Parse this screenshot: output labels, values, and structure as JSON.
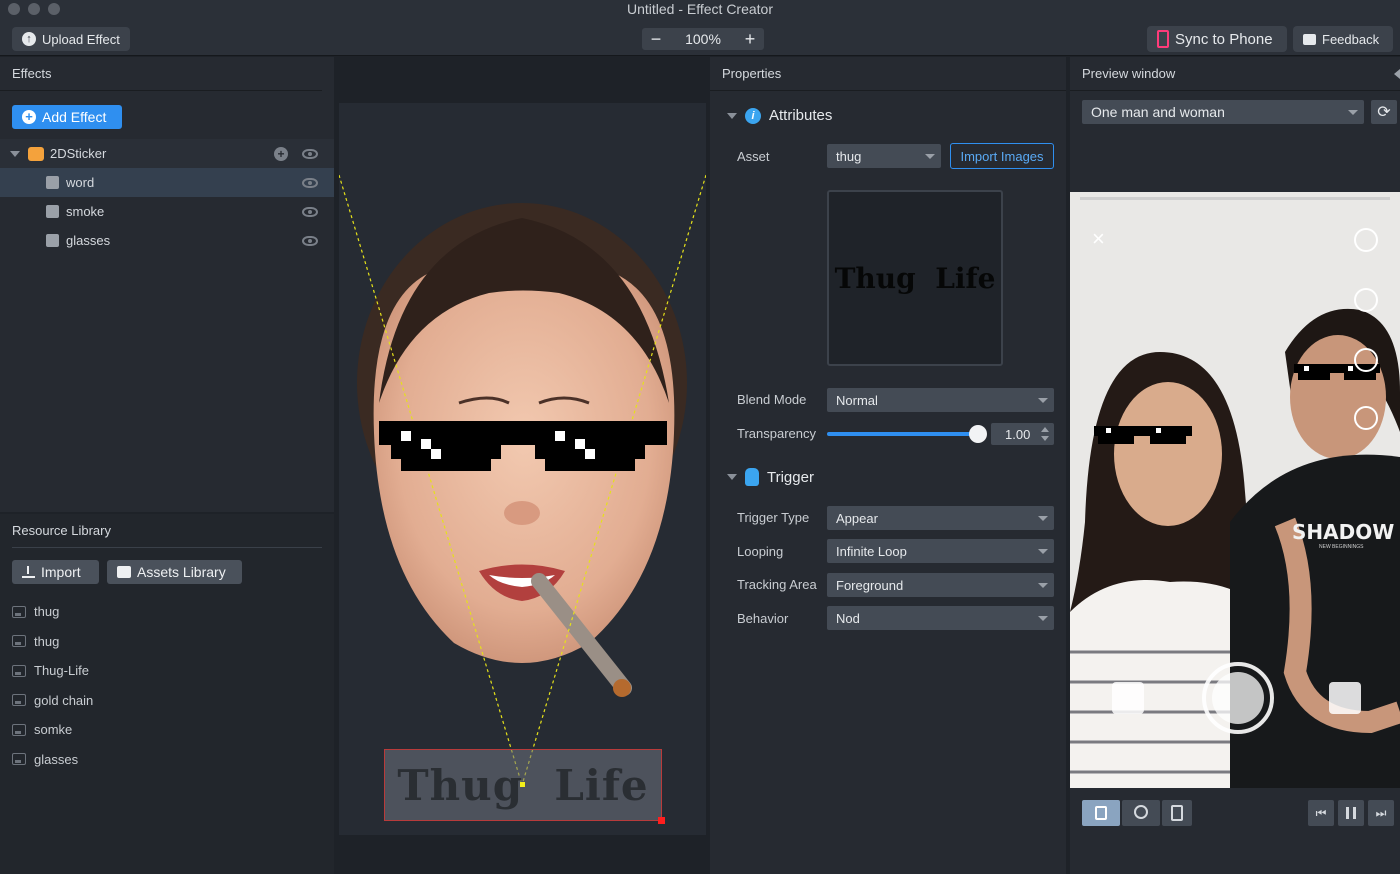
{
  "window": {
    "title": "Untitled - Effect Creator"
  },
  "toolbar": {
    "upload_label": "Upload Effect",
    "zoom_minus": "−",
    "zoom_value": "100%",
    "zoom_plus": "+",
    "sync_label": "Sync to Phone",
    "feedback_label": "Feedback"
  },
  "effects_panel": {
    "title": "Effects",
    "add_label": "Add Effect",
    "group": "2DSticker",
    "items": [
      {
        "label": "word",
        "selected": true
      },
      {
        "label": "smoke",
        "selected": false
      },
      {
        "label": "glasses",
        "selected": false
      }
    ]
  },
  "resource_panel": {
    "title": "Resource Library",
    "import_label": "Import",
    "assets_label": "Assets Library",
    "items": [
      {
        "label": "thug"
      },
      {
        "label": "thug"
      },
      {
        "label": "Thug-Life"
      },
      {
        "label": "gold chain"
      },
      {
        "label": "somke"
      },
      {
        "label": "glasses"
      }
    ]
  },
  "canvas": {
    "sticker_text": "Thug  Life"
  },
  "properties": {
    "title": "Properties",
    "attributes_title": "Attributes",
    "asset_label": "Asset",
    "asset_value": "thug",
    "import_images_label": "Import Images",
    "preview_text": "Thug  Life",
    "blend_label": "Blend Mode",
    "blend_value": "Normal",
    "transparency_label": "Transparency",
    "transparency_value": "1.00",
    "trigger_title": "Trigger",
    "trigger_type_label": "Trigger Type",
    "trigger_type_value": "Appear",
    "looping_label": "Looping",
    "looping_value": "Infinite Loop",
    "tracking_label": "Tracking Area",
    "tracking_value": "Foreground",
    "behavior_label": "Behavior",
    "behavior_value": "Nod"
  },
  "preview": {
    "title": "Preview window",
    "scene_value": "One man and woman",
    "shirt_text": "SHADOW",
    "shirt_subtext": "NEW BEGINNINGS"
  },
  "colors": {
    "accent": "#2f8ff0",
    "panel": "#262a31",
    "canvas": "#1e2228"
  }
}
